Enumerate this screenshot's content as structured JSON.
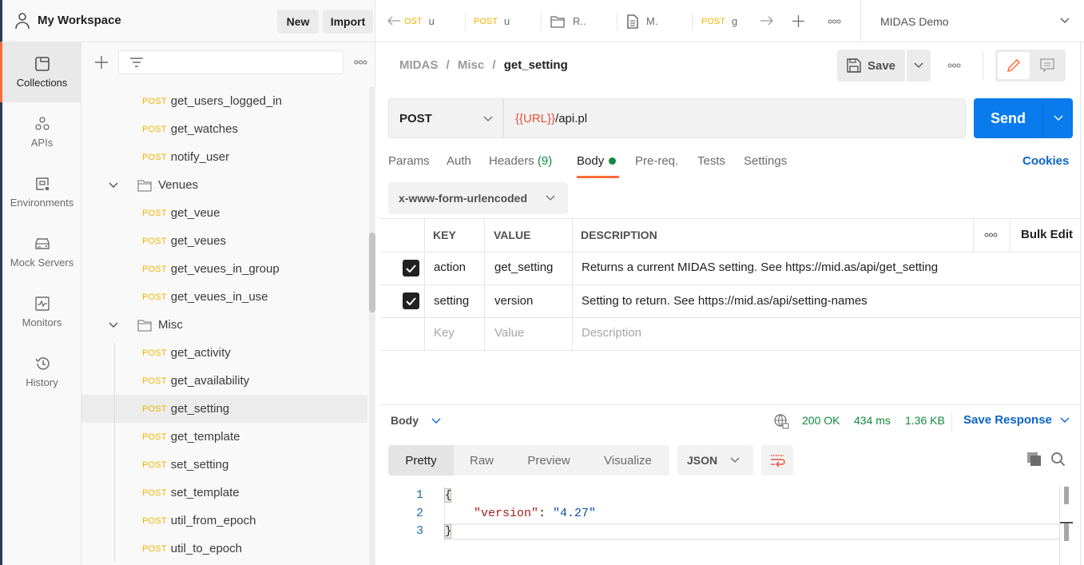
{
  "workspace": {
    "title": "My Workspace",
    "new_label": "New",
    "import_label": "Import"
  },
  "leftnav": [
    {
      "label": "Collections",
      "icon": "collections-icon",
      "active": true
    },
    {
      "label": "APIs",
      "icon": "apis-icon"
    },
    {
      "label": "Environments",
      "icon": "environments-icon"
    },
    {
      "label": "Mock Servers",
      "icon": "mock-servers-icon"
    },
    {
      "label": "Monitors",
      "icon": "monitors-icon"
    },
    {
      "label": "History",
      "icon": "history-icon"
    }
  ],
  "tree": {
    "method": "POST",
    "rows": [
      {
        "type": "request",
        "name": "get_users_logged_in"
      },
      {
        "type": "request",
        "name": "get_watches"
      },
      {
        "type": "request",
        "name": "notify_user"
      },
      {
        "type": "folder",
        "name": "Venues"
      },
      {
        "type": "request",
        "name": "get_veue"
      },
      {
        "type": "request",
        "name": "get_veues"
      },
      {
        "type": "request",
        "name": "get_veues_in_group"
      },
      {
        "type": "request",
        "name": "get_veues_in_use"
      },
      {
        "type": "folder",
        "name": "Misc"
      },
      {
        "type": "request",
        "name": "get_activity"
      },
      {
        "type": "request",
        "name": "get_availability"
      },
      {
        "type": "request",
        "name": "get_setting",
        "selected": true
      },
      {
        "type": "request",
        "name": "get_template"
      },
      {
        "type": "request",
        "name": "set_setting"
      },
      {
        "type": "request",
        "name": "set_template"
      },
      {
        "type": "request",
        "name": "util_from_epoch"
      },
      {
        "type": "request",
        "name": "util_to_epoch"
      }
    ]
  },
  "tabs": [
    {
      "method": "OST",
      "label": "u"
    },
    {
      "method": "POST",
      "label": "u"
    },
    {
      "icon": "folder-icon",
      "label": "R.."
    },
    {
      "icon": "document-icon",
      "label": "M."
    },
    {
      "method": "POST",
      "label": "g"
    }
  ],
  "environment": {
    "selected": "MIDAS Demo"
  },
  "breadcrumb": {
    "items": [
      "MIDAS",
      "Misc"
    ],
    "current": "get_setting",
    "sep": "/"
  },
  "toolbar": {
    "save_label": "Save"
  },
  "request": {
    "method": "POST",
    "url_var": "{{URL}}",
    "url_path": "/api.pl",
    "send_label": "Send"
  },
  "request_tabs": [
    {
      "label": "Params"
    },
    {
      "label": "Auth"
    },
    {
      "label": "Headers",
      "count": "(9)"
    },
    {
      "label": "Body",
      "active": true
    },
    {
      "label": "Pre-req."
    },
    {
      "label": "Tests"
    },
    {
      "label": "Settings"
    }
  ],
  "cookies_label": "Cookies",
  "body_type": "x-www-form-urlencoded",
  "params_table": {
    "headers": {
      "key": "KEY",
      "value": "VALUE",
      "description": "DESCRIPTION",
      "bulk_edit": "Bulk Edit"
    },
    "rows": [
      {
        "checked": true,
        "key": "action",
        "value": "get_setting",
        "description": "Returns a current MIDAS setting. See https://mid.as/api/get_setting"
      },
      {
        "checked": true,
        "key": "setting",
        "value": "version",
        "description": "Setting to return. See https://mid.as/api/setting-names"
      }
    ],
    "placeholders": {
      "key": "Key",
      "value": "Value",
      "description": "Description"
    }
  },
  "response": {
    "section_label": "Body",
    "status": "200 OK",
    "time": "434 ms",
    "size": "1.36 KB",
    "save_label": "Save Response",
    "views": [
      "Pretty",
      "Raw",
      "Preview",
      "Visualize"
    ],
    "active_view": "Pretty",
    "format": "JSON",
    "lines": [
      "1",
      "2",
      "3"
    ],
    "open_brace": "{",
    "close_brace": "}",
    "json_key": "\"version\"",
    "json_colon": ": ",
    "json_value": "\"4.27\""
  },
  "colors": {
    "accent": "#ff6c37",
    "send": "#097bed",
    "method_post": "#f0b400",
    "status_ok": "#0f8a3e",
    "link": "#0b65c9"
  }
}
